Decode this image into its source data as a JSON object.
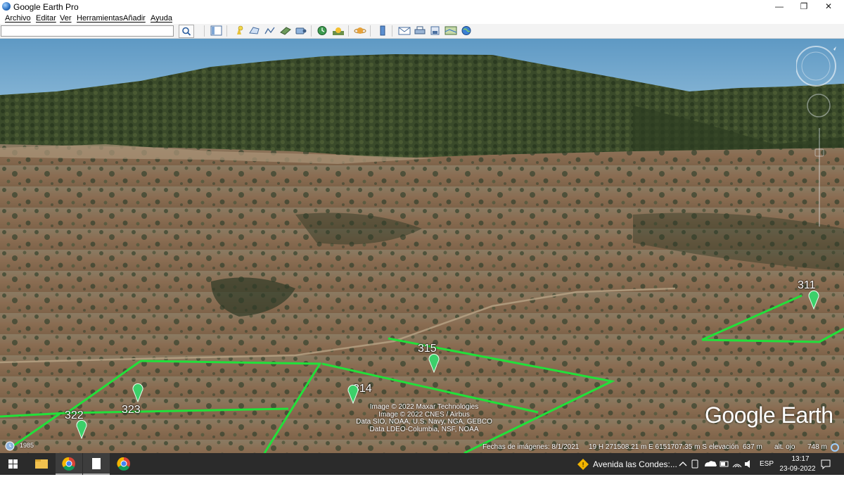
{
  "window": {
    "title": "Google Earth Pro"
  },
  "menu": {
    "items": [
      "Archivo",
      "Editar",
      "Ver",
      "Herramientas",
      "Añadir",
      "Ayuda"
    ]
  },
  "toolbar": {
    "search_value": "",
    "icons": [
      "search-icon",
      "sidebar-toggle-icon",
      "placemark-icon",
      "polygon-icon",
      "path-icon",
      "image-overlay-icon",
      "record-tour-icon",
      "historical-imagery-icon",
      "sunlight-icon",
      "planets-icon",
      "ruler-icon",
      "email-icon",
      "print-icon",
      "save-image-icon",
      "view-maps-icon",
      "earth-gallery-icon"
    ]
  },
  "map": {
    "placemarks": [
      {
        "label": "311"
      },
      {
        "label": "315"
      },
      {
        "label": "314"
      },
      {
        "label": "323"
      },
      {
        "label": "322"
      }
    ],
    "credits": [
      "Image © 2022 Maxar Technologies",
      "Image © 2022 CNES / Airbus",
      "Data SIO, NOAA, U.S. Navy, NGA, GEBCO",
      "Data LDEO-Columbia, NSF, NOAA"
    ],
    "brand": "Google Earth",
    "historical_year": "1985",
    "status": {
      "imagery_date": "Fechas de imágenes: 8/1/2021",
      "coords": "19 H 271508.21 m E 6151707.35 m S",
      "elevation_label": "elevación",
      "elevation_value": "637 m",
      "eye_alt_label": "alt. ojo",
      "eye_alt_value": "748 m"
    },
    "colors": {
      "boundary": "#22e03a",
      "placemark": "#3cd06a",
      "sky": "#6fa8cf"
    }
  },
  "taskbar": {
    "apps": [
      "start-icon",
      "file-explorer-icon",
      "chrome-icon",
      "notepad-icon",
      "chrome-icon"
    ],
    "notification": "Avenida las Condes:...",
    "language": "ESP",
    "time": "13:17",
    "date": "23-09-2022"
  }
}
